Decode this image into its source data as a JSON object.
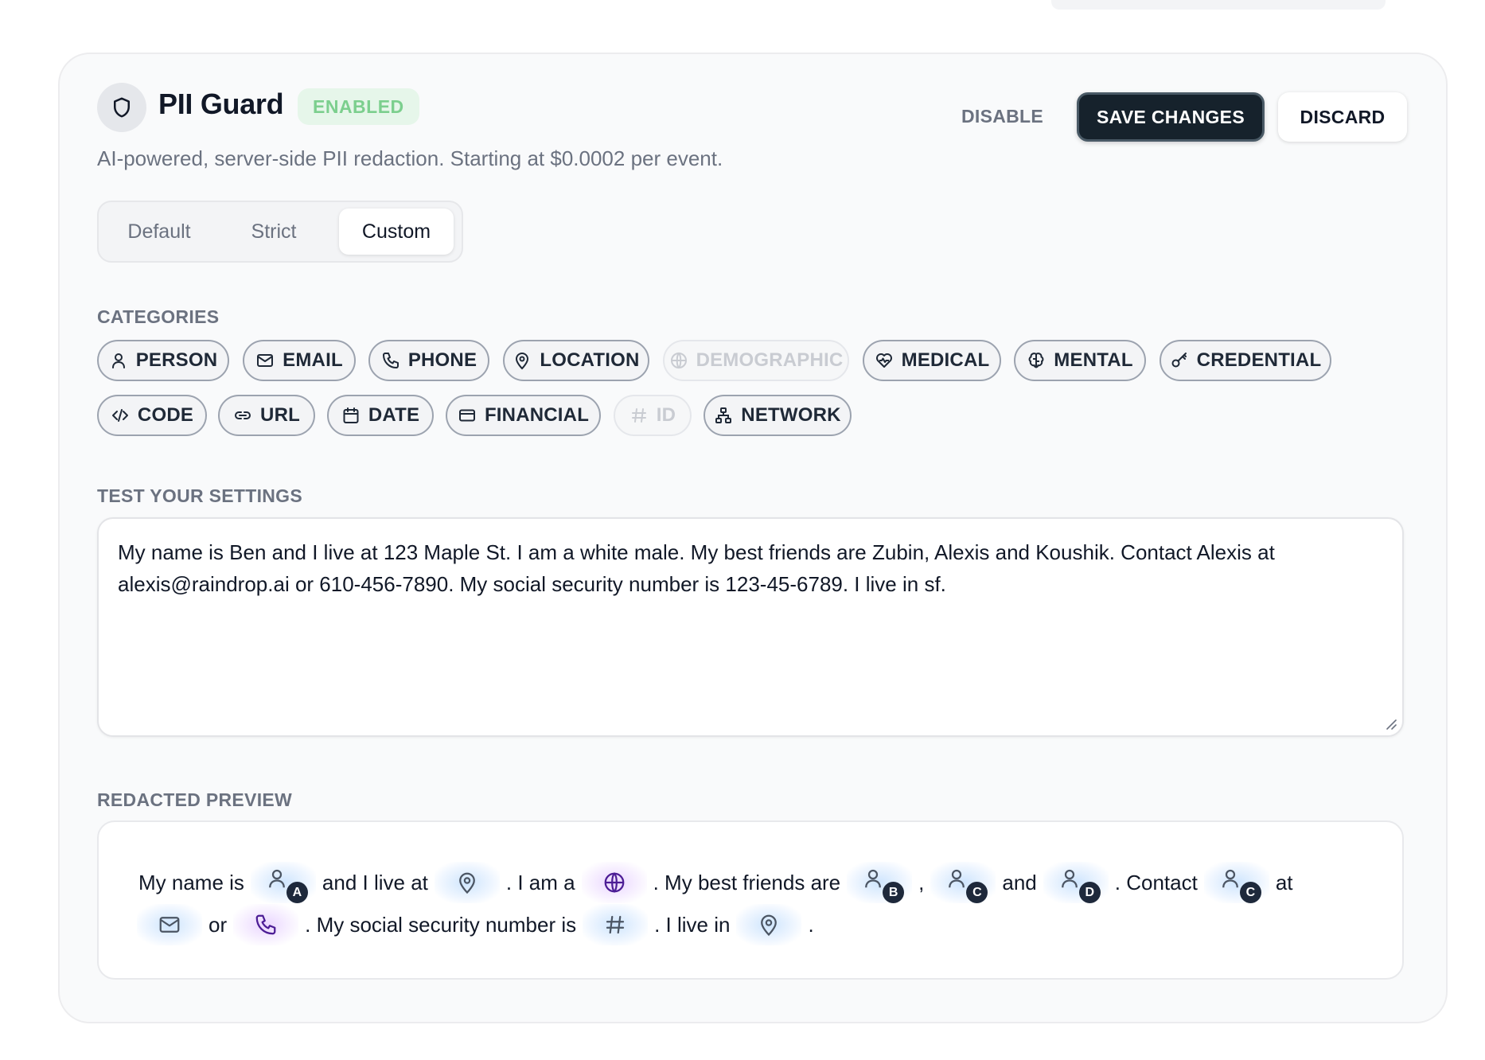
{
  "header": {
    "title": "PII Guard",
    "status_badge": "ENABLED",
    "subtitle": "AI-powered, server-side PII redaction. Starting at $0.0002 per event.",
    "disable_label": "DISABLE",
    "save_label": "SAVE CHANGES",
    "discard_label": "DISCARD"
  },
  "presets": {
    "options": [
      "Default",
      "Strict",
      "Custom"
    ],
    "selected": "Custom"
  },
  "categories": {
    "label": "CATEGORIES",
    "items": [
      {
        "label": "PERSON",
        "icon": "person-icon",
        "enabled": true
      },
      {
        "label": "EMAIL",
        "icon": "mail-icon",
        "enabled": true
      },
      {
        "label": "PHONE",
        "icon": "phone-icon",
        "enabled": true
      },
      {
        "label": "LOCATION",
        "icon": "map-pin-icon",
        "enabled": true
      },
      {
        "label": "DEMOGRAPHIC",
        "icon": "globe-icon",
        "enabled": false
      },
      {
        "label": "MEDICAL",
        "icon": "heart-pulse-icon",
        "enabled": true
      },
      {
        "label": "MENTAL",
        "icon": "brain-icon",
        "enabled": true
      },
      {
        "label": "CREDENTIAL",
        "icon": "key-icon",
        "enabled": true
      },
      {
        "label": "CODE",
        "icon": "code-icon",
        "enabled": true
      },
      {
        "label": "URL",
        "icon": "link-icon",
        "enabled": true
      },
      {
        "label": "DATE",
        "icon": "calendar-icon",
        "enabled": true
      },
      {
        "label": "FINANCIAL",
        "icon": "credit-card-icon",
        "enabled": true
      },
      {
        "label": "ID",
        "icon": "hash-icon",
        "enabled": false
      },
      {
        "label": "NETWORK",
        "icon": "network-icon",
        "enabled": true
      }
    ]
  },
  "test": {
    "label": "TEST YOUR SETTINGS",
    "value": "My name is Ben and I live at 123 Maple St. I am a white male. My best friends are Zubin, Alexis and Koushik. Contact Alexis at alexis@raindrop.ai or 610-456-7890. My social security number is 123-45-6789. I live in sf."
  },
  "preview": {
    "label": "REDACTED PREVIEW",
    "line1": {
      "t1": "My name is",
      "person_a": "A",
      "t2": "and I live at",
      "t3": ". I am a",
      "t4": ". My best friends are",
      "person_b": "B",
      "comma": ",",
      "person_c": "C",
      "t5": "and",
      "person_d": "D",
      "t6": ". Contact",
      "person_c2": "C",
      "t7": "at"
    },
    "line2": {
      "t1": "or",
      "t2": ". My social security number is",
      "t3": ". I live in",
      "t4": "."
    }
  }
}
